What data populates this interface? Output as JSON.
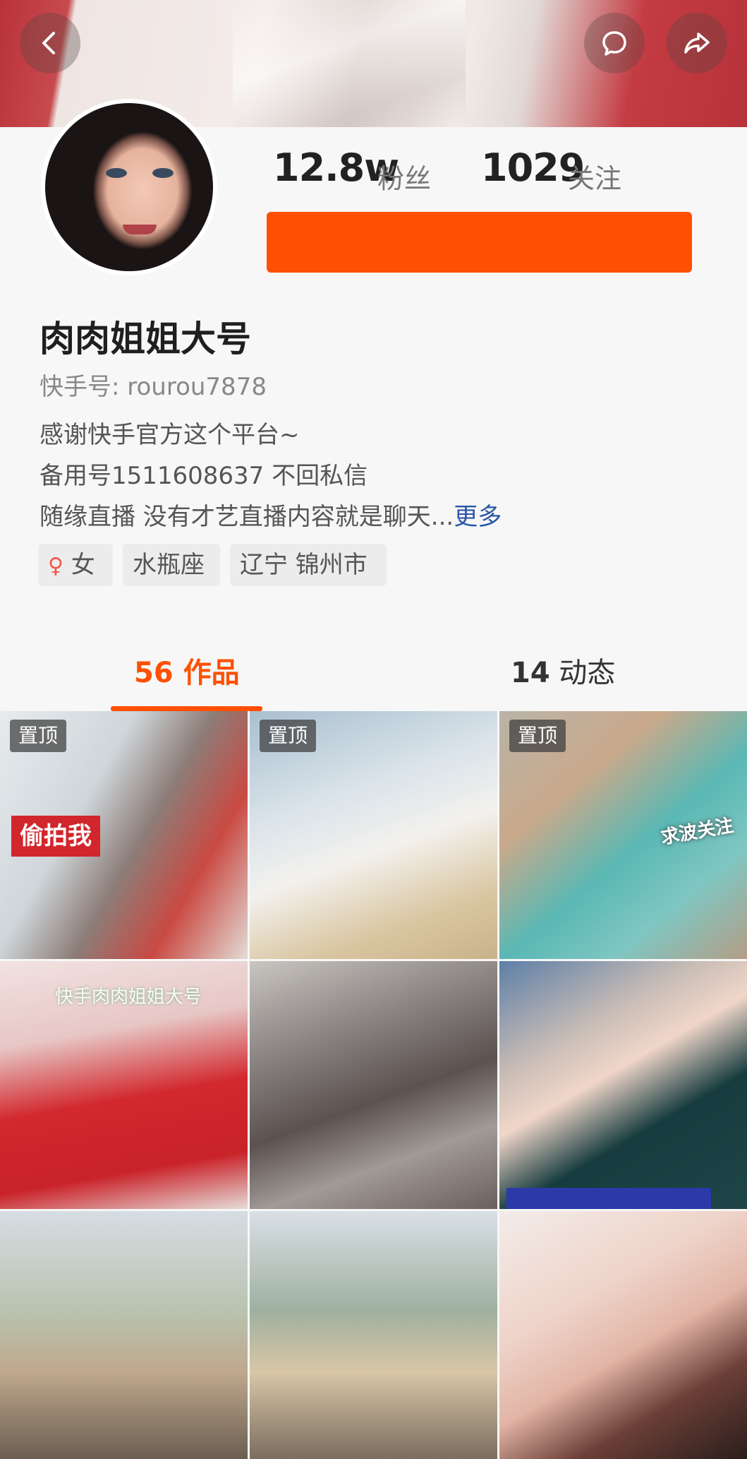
{
  "header": {
    "back_icon": "chevron-left-icon",
    "message_icon": "speech-bubble-icon",
    "share_icon": "share-arrow-icon"
  },
  "profile": {
    "fans_count": "12.8w",
    "fans_label": "粉丝",
    "following_count": "1029",
    "following_label": "关注",
    "name": "肉肉姐姐大号",
    "user_id": "快手号: rourou7878",
    "bio_lines": [
      "感谢快手官方这个平台~",
      "备用号1511608637 不回私信",
      "随缘直播 没有才艺直播内容就是聊天..."
    ],
    "more_label": "更多",
    "tags": {
      "gender": "女",
      "zodiac": "水瓶座",
      "location": "辽宁 锦州市"
    }
  },
  "tabs": [
    {
      "count": "56",
      "label": "作品"
    },
    {
      "count": "14",
      "label": "动态"
    }
  ],
  "posts": [
    {
      "pin": "置顶",
      "caption": "偷拍我"
    },
    {
      "pin": "置顶"
    },
    {
      "pin": "置顶",
      "sticker": "求波关注"
    },
    {
      "watermark": "快手肉肉姐姐大号"
    },
    {},
    {},
    {},
    {},
    {}
  ],
  "colors": {
    "accent": "#fe5000",
    "link": "#2a55a6",
    "pin_bg": "rgba(60,60,60,0.72)",
    "caption_red": "#d1262c"
  }
}
